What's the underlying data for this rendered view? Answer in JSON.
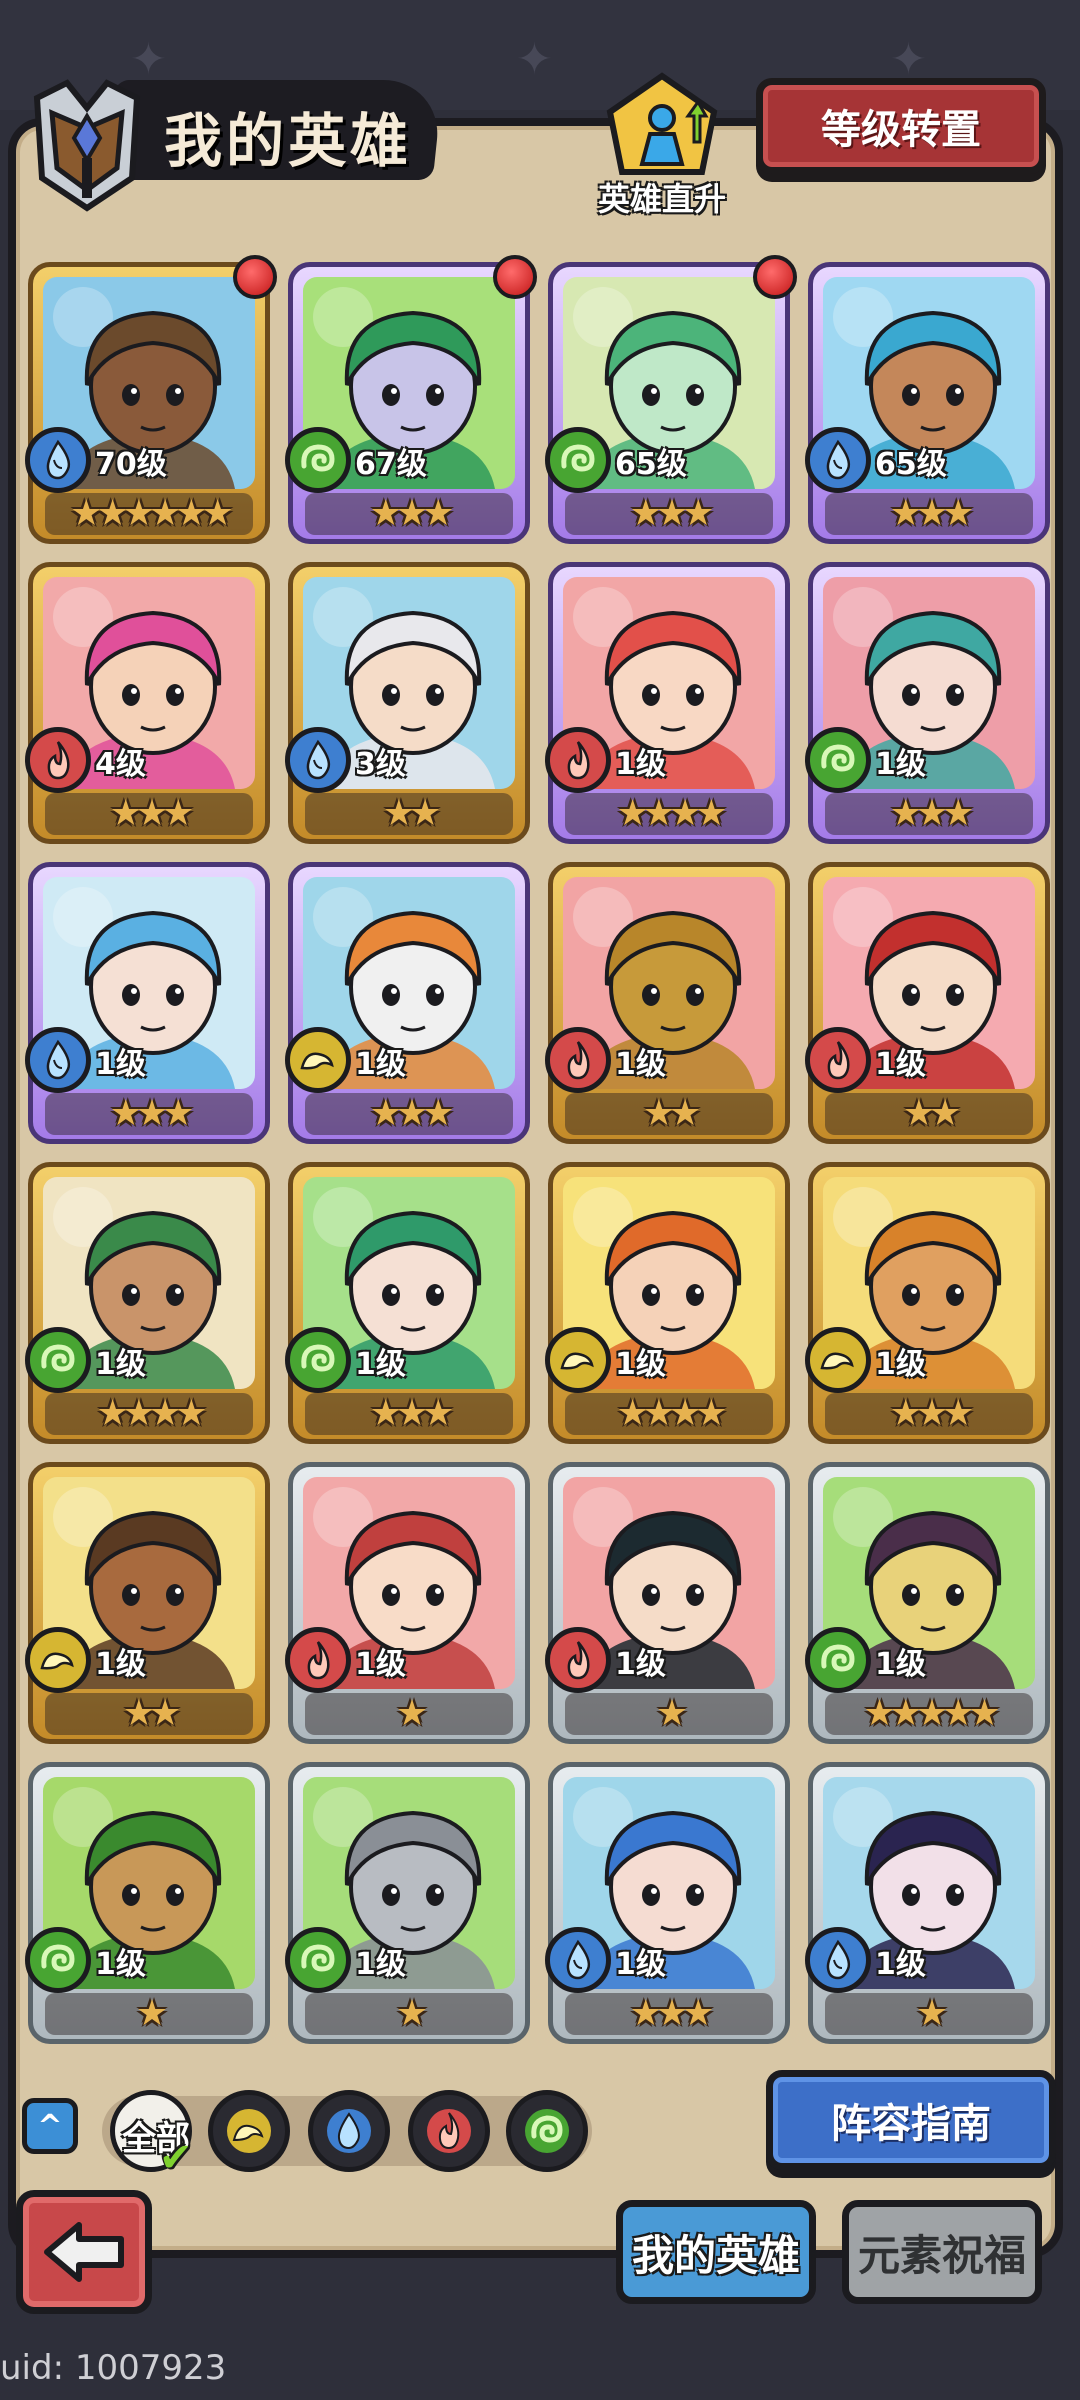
{
  "header": {
    "title": "我的英雄",
    "direct_upgrade_label": "英雄直升",
    "level_reset_label": "等级转置"
  },
  "heroes": [
    {
      "level": "70级",
      "stars": "★★★★★★",
      "element": "water",
      "frame": "gold",
      "dot": true,
      "bg": "#8bc9e8",
      "skin": "#8a5a3a",
      "hair": "#6b4a2c"
    },
    {
      "level": "67级",
      "stars": "★★★",
      "element": "wood",
      "frame": "purple",
      "dot": true,
      "bg": "#a8e07a",
      "skin": "#c8c4e8",
      "hair": "#2f9a5a"
    },
    {
      "level": "65级",
      "stars": "★★★",
      "element": "wood",
      "frame": "purple",
      "dot": true,
      "bg": "#d7e8b2",
      "skin": "#bfe8c8",
      "hair": "#4cb47a"
    },
    {
      "level": "65级",
      "stars": "★★★",
      "element": "water",
      "frame": "purple",
      "dot": false,
      "bg": "#9fd8f2",
      "skin": "#c4875a",
      "hair": "#3aa8d0"
    },
    {
      "level": "4级",
      "stars": "★★★",
      "element": "fire",
      "frame": "gold",
      "dot": false,
      "bg": "#f2a9a9",
      "skin": "#f5d2b8",
      "hair": "#e0509a"
    },
    {
      "level": "3级",
      "stars": "★★",
      "element": "water",
      "frame": "gold",
      "dot": false,
      "bg": "#9fd6ea",
      "skin": "#f5dcc8",
      "hair": "#e8e8ec"
    },
    {
      "level": "1级",
      "stars": "★★★★",
      "element": "fire",
      "frame": "purple",
      "dot": false,
      "bg": "#f2a6a6",
      "skin": "#f8d8c4",
      "hair": "#e2504a"
    },
    {
      "level": "1级",
      "stars": "★★★",
      "element": "wood",
      "frame": "purple",
      "dot": false,
      "bg": "#ee9ea8",
      "skin": "#f5dcd2",
      "hair": "#3fa8a2"
    },
    {
      "level": "1级",
      "stars": "★★★",
      "element": "water",
      "frame": "purple",
      "dot": false,
      "bg": "#cfeaf5",
      "skin": "#f5e0d4",
      "hair": "#5ab0e2"
    },
    {
      "level": "1级",
      "stars": "★★★",
      "element": "earth",
      "frame": "purple",
      "dot": false,
      "bg": "#9fd6ea",
      "skin": "#f0f0f0",
      "hair": "#e8883a"
    },
    {
      "level": "1级",
      "stars": "★★",
      "element": "fire",
      "frame": "gold",
      "dot": false,
      "bg": "#f2a4a4",
      "skin": "#c79a3a",
      "hair": "#b8862a"
    },
    {
      "level": "1级",
      "stars": "★★",
      "element": "fire",
      "frame": "gold",
      "dot": false,
      "bg": "#f5aab0",
      "skin": "#f5dcc8",
      "hair": "#c2302e"
    },
    {
      "level": "1级",
      "stars": "★★★★",
      "element": "wood",
      "frame": "gold",
      "dot": false,
      "bg": "#f0e4c2",
      "skin": "#c9946a",
      "hair": "#3a8a4a"
    },
    {
      "level": "1级",
      "stars": "★★★",
      "element": "wood",
      "frame": "gold",
      "dot": false,
      "bg": "#a6e08a",
      "skin": "#f5e0d4",
      "hair": "#2f9a6a"
    },
    {
      "level": "1级",
      "stars": "★★★★",
      "element": "earth",
      "frame": "gold",
      "dot": false,
      "bg": "#f7e27a",
      "skin": "#f5d2b8",
      "hair": "#e06a2a"
    },
    {
      "level": "1级",
      "stars": "★★★",
      "element": "earth",
      "frame": "gold",
      "dot": false,
      "bg": "#f5dc7a",
      "skin": "#e0a060",
      "hair": "#d8822a"
    },
    {
      "level": "1级",
      "stars": "★★",
      "element": "earth",
      "frame": "gold",
      "dot": false,
      "bg": "#f3e08a",
      "skin": "#a86a3e",
      "hair": "#5a3a22"
    },
    {
      "level": "1级",
      "stars": "★",
      "element": "fire",
      "frame": "silver",
      "dot": false,
      "bg": "#f2a8a8",
      "skin": "#f8dcc8",
      "hair": "#c0403e"
    },
    {
      "level": "1级",
      "stars": "★",
      "element": "fire",
      "frame": "silver",
      "dot": false,
      "bg": "#f2a4a4",
      "skin": "#f5dcc8",
      "hair": "#1c2a30"
    },
    {
      "level": "1级",
      "stars": "★★★★★",
      "element": "wood",
      "frame": "silver",
      "dot": false,
      "bg": "#a6dd7a",
      "skin": "#e8d27a",
      "hair": "#4a2e4a"
    },
    {
      "level": "1级",
      "stars": "★",
      "element": "wood",
      "frame": "silver",
      "dot": false,
      "bg": "#a6d96a",
      "skin": "#c89858",
      "hair": "#3a8a2e"
    },
    {
      "level": "1级",
      "stars": "★",
      "element": "wood",
      "frame": "silver",
      "dot": false,
      "bg": "#a6dd7a",
      "skin": "#b8bcc2",
      "hair": "#8a8f96"
    },
    {
      "level": "1级",
      "stars": "★★★",
      "element": "water",
      "frame": "silver",
      "dot": false,
      "bg": "#9fd6ea",
      "skin": "#f5dcd2",
      "hair": "#3a78d0"
    },
    {
      "level": "1级",
      "stars": "★",
      "element": "water",
      "frame": "silver",
      "dot": false,
      "bg": "#a6d8ec",
      "skin": "#f2e0e8",
      "hair": "#2a2450"
    }
  ],
  "filters": {
    "all_label": "全部",
    "elements": [
      "earth-filter-icon",
      "water-filter-icon",
      "fire-filter-icon",
      "wood-filter-icon"
    ]
  },
  "lineup_guide_label": "阵容指南",
  "tabs": {
    "my_heroes": "我的英雄",
    "element_blessing": "元素祝福"
  },
  "uid": "uid: 1007923",
  "colors": {
    "water": "#3e7fd0",
    "wood": "#48a532",
    "fire": "#d44a4a",
    "earth": "#d6b632",
    "accent_red": "#a63436",
    "accent_blue": "#3d6fc8"
  }
}
